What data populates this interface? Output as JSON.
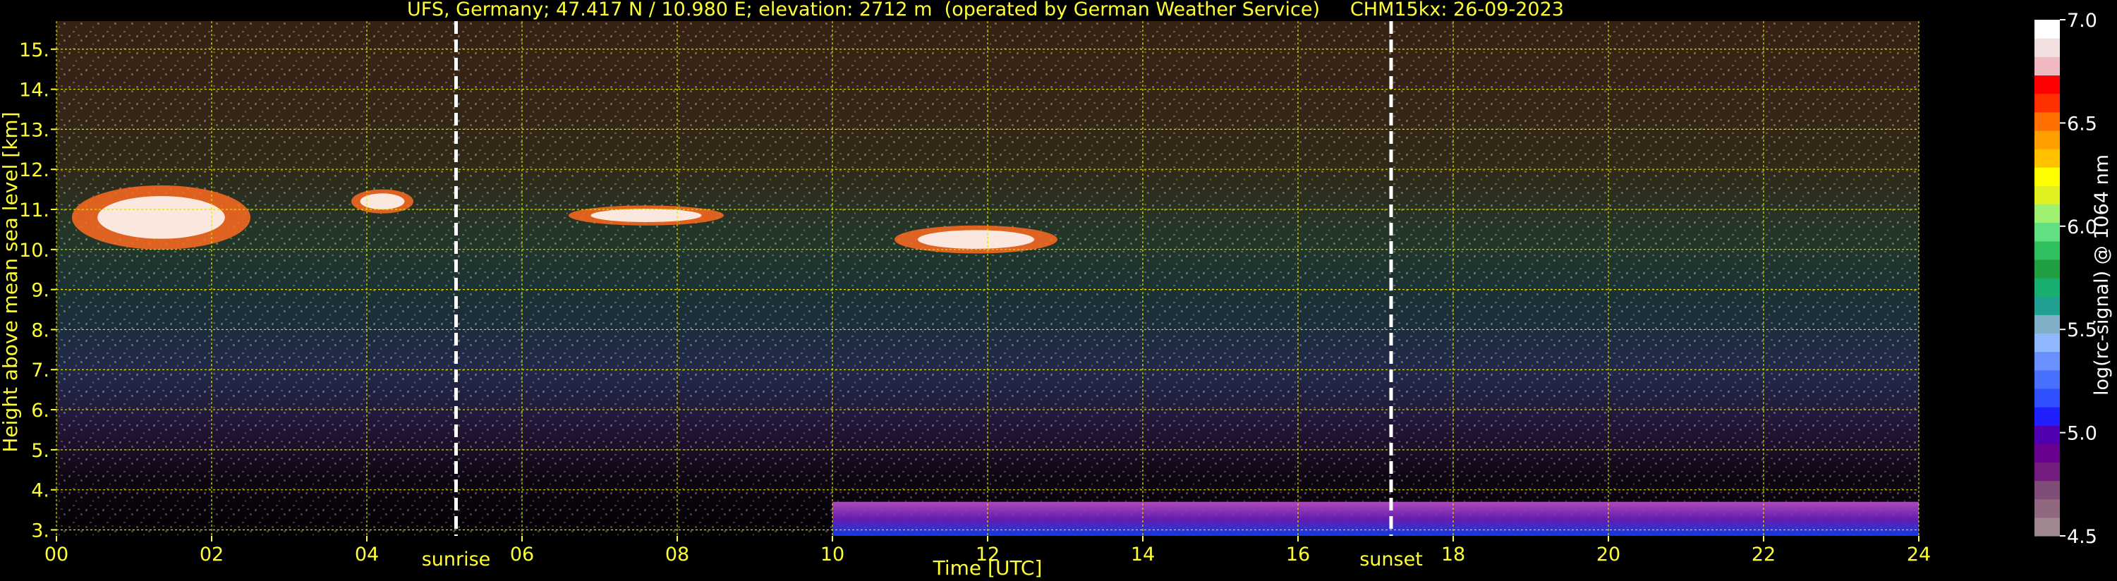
{
  "chart_data": {
    "type": "heatmap",
    "title": "UFS, Germany; 47.417 N / 10.980 E; elevation: 2712 m  (operated by German Weather Service)     CHM15kx: 26-09-2023",
    "xlabel": "Time [UTC]",
    "ylabel": "Height above mean sea level [km]",
    "xlim": [
      0,
      24
    ],
    "ylim": [
      2.85,
      15.7
    ],
    "x_ticks": [
      0,
      2,
      4,
      6,
      8,
      10,
      12,
      14,
      16,
      18,
      20,
      22,
      24
    ],
    "x_tick_labels": [
      "00",
      "02",
      "04",
      "06",
      "08",
      "10",
      "12",
      "14",
      "16",
      "18",
      "20",
      "22",
      "24"
    ],
    "y_ticks": [
      3,
      4,
      5,
      6,
      7,
      8,
      9,
      10,
      11,
      12,
      13,
      14,
      15
    ],
    "y_tick_labels": [
      "3.",
      "4.",
      "5.",
      "6.",
      "7.",
      "8.",
      "9.",
      "10.",
      "11.",
      "12.",
      "13.",
      "14.",
      "15."
    ],
    "grid": true,
    "annotations": [
      {
        "text": "sunrise",
        "x": 5.15
      },
      {
        "text": "sunset",
        "x": 17.2
      }
    ],
    "colorbar": {
      "label": "log(rc-signal) @ 1064 nm",
      "range": [
        4.5,
        7.0
      ],
      "ticks": [
        4.5,
        5.0,
        5.5,
        6.0,
        6.5,
        7.0
      ],
      "tick_labels": [
        "4.5",
        "5.0",
        "5.5",
        "6.0",
        "6.5",
        "7.0"
      ],
      "colors": [
        "#a08890",
        "#906880",
        "#804c78",
        "#741c80",
        "#6a0090",
        "#5000b0",
        "#2020ff",
        "#3050ff",
        "#4870ff",
        "#6a90ff",
        "#90b8ff",
        "#80b0c8",
        "#20a090",
        "#18b070",
        "#20a040",
        "#30c060",
        "#60e080",
        "#a0f070",
        "#e0f020",
        "#ffff00",
        "#ffc000",
        "#ffa000",
        "#ff7000",
        "#ff3000",
        "#ff0000",
        "#f0b8c0",
        "#f0e0e0",
        "#ffffff"
      ]
    },
    "features": [
      {
        "type": "cloud",
        "time_range": [
          0.2,
          2.5
        ],
        "height_range": [
          10.0,
          11.6
        ]
      },
      {
        "type": "cloud",
        "time_range": [
          3.8,
          4.6
        ],
        "height_range": [
          10.9,
          11.5
        ]
      },
      {
        "type": "cloud",
        "time_range": [
          6.6,
          8.6
        ],
        "height_range": [
          10.6,
          11.1
        ]
      },
      {
        "type": "cloud",
        "time_range": [
          10.8,
          12.9
        ],
        "height_range": [
          9.9,
          10.6
        ]
      },
      {
        "type": "boundary_layer",
        "time_range": [
          10,
          24
        ],
        "height_range": [
          2.85,
          3.7
        ]
      }
    ]
  }
}
